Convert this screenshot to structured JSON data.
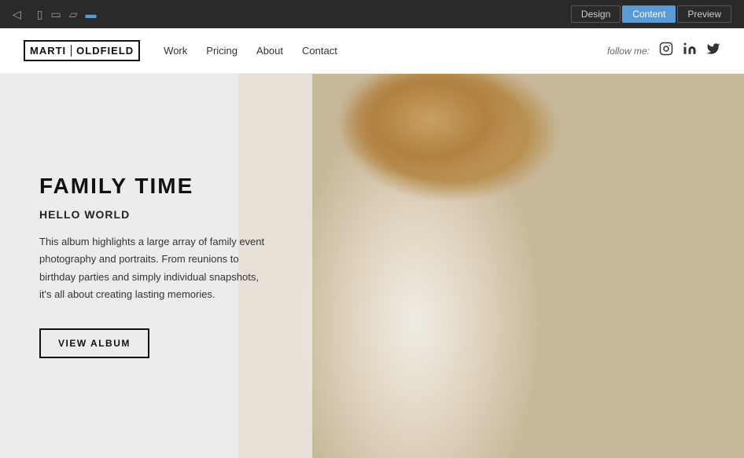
{
  "topbar": {
    "design_label": "Design",
    "content_label": "Content",
    "preview_label": "Preview",
    "active_mode": "Content"
  },
  "devices": [
    {
      "name": "unknown-icon",
      "symbol": "⊞"
    },
    {
      "name": "tablet-portrait-icon",
      "symbol": "▯"
    },
    {
      "name": "tablet-landscape-icon",
      "symbol": "▭"
    },
    {
      "name": "mobile-icon",
      "symbol": "▱"
    },
    {
      "name": "desktop-icon",
      "symbol": "▬"
    }
  ],
  "nav": {
    "logo_first": "MARTI",
    "logo_second": "OLDFIELD",
    "links": [
      "Work",
      "Pricing",
      "About",
      "Contact"
    ],
    "follow_label": "follow me:",
    "social_icons": [
      "instagram",
      "linkedin",
      "twitter"
    ]
  },
  "hero": {
    "title": "FAMILY TIME",
    "subtitle": "HELLO WORLD",
    "description": "This album highlights a large array of family event photography and portraits. From reunions to birthday parties and simply individual snapshots, it's all about creating lasting memories.",
    "button_label": "VIEW ALBUM"
  }
}
